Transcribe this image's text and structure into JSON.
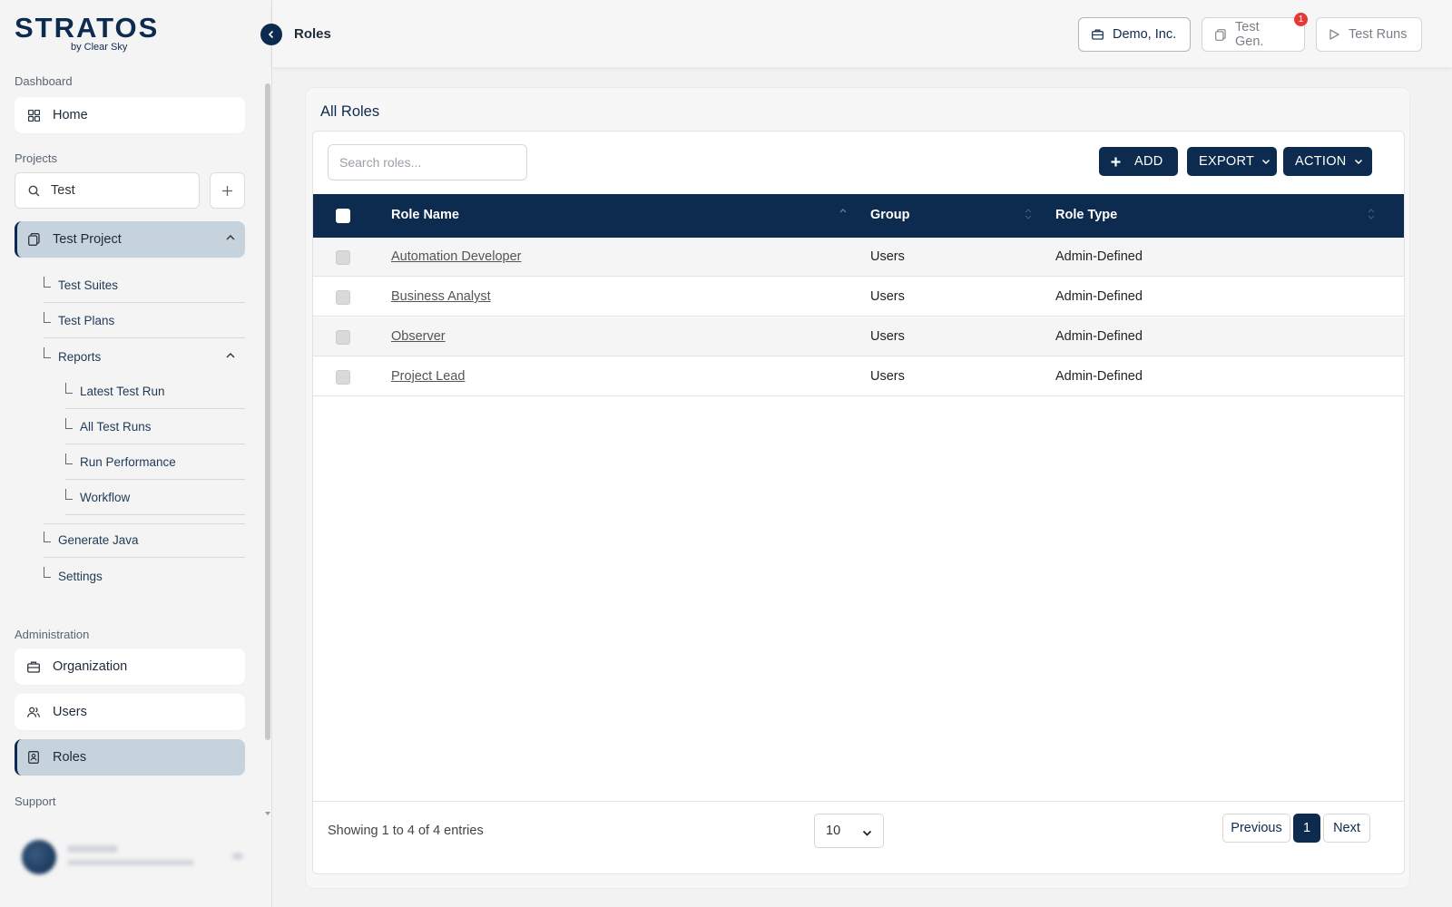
{
  "brand": {
    "name": "STRATOS",
    "tagline": "by Clear Sky"
  },
  "sidebar": {
    "dashboard_label": "Dashboard",
    "home": {
      "label": "Home",
      "icon": "grid-icon"
    },
    "projects_label": "Projects",
    "project_search": {
      "value": "Test",
      "icon": "search-icon"
    },
    "add_project": "+",
    "project": {
      "label": "Test Project",
      "icon": "document-icon"
    },
    "tree": [
      {
        "label": "Test Suites"
      },
      {
        "label": "Test Plans"
      },
      {
        "label": "Reports"
      },
      {
        "label": "Latest Test Run"
      },
      {
        "label": "All Test Runs"
      },
      {
        "label": "Run Performance"
      },
      {
        "label": "Workflow"
      },
      {
        "label": "Generate Java"
      },
      {
        "label": "Settings"
      }
    ],
    "administration_label": "Administration",
    "admin_items": [
      {
        "label": "Organization",
        "icon": "briefcase-icon"
      },
      {
        "label": "Users",
        "icon": "users-icon"
      },
      {
        "label": "Roles",
        "icon": "badge-icon"
      }
    ],
    "support_label": "Support"
  },
  "header": {
    "title": "Roles",
    "buttons": {
      "org": "Demo, Inc.",
      "testgen": "Test Gen.",
      "testgen_badge": "1",
      "testruns": "Test Runs"
    }
  },
  "main": {
    "title": "All Roles",
    "search_placeholder": "Search roles...",
    "actions": {
      "add": "ADD",
      "export": "EXPORT",
      "action": "ACTION"
    },
    "columns": [
      "Role Name",
      "Group",
      "Role Type"
    ],
    "rows": [
      {
        "name": "Automation Developer",
        "group": "Users",
        "type": "Admin-Defined"
      },
      {
        "name": "Business Analyst",
        "group": "Users",
        "type": "Admin-Defined"
      },
      {
        "name": "Observer",
        "group": "Users",
        "type": "Admin-Defined"
      },
      {
        "name": "Project Lead",
        "group": "Users",
        "type": "Admin-Defined"
      }
    ],
    "entries_text": "Showing 1 to 4 of 4 entries",
    "page_size": "10",
    "pagination": {
      "previous": "Previous",
      "current": "1",
      "next": "Next"
    }
  },
  "colors": {
    "primary": "#0d2b4e",
    "active_bg": "#c6d3dd",
    "badge": "#e53935"
  }
}
